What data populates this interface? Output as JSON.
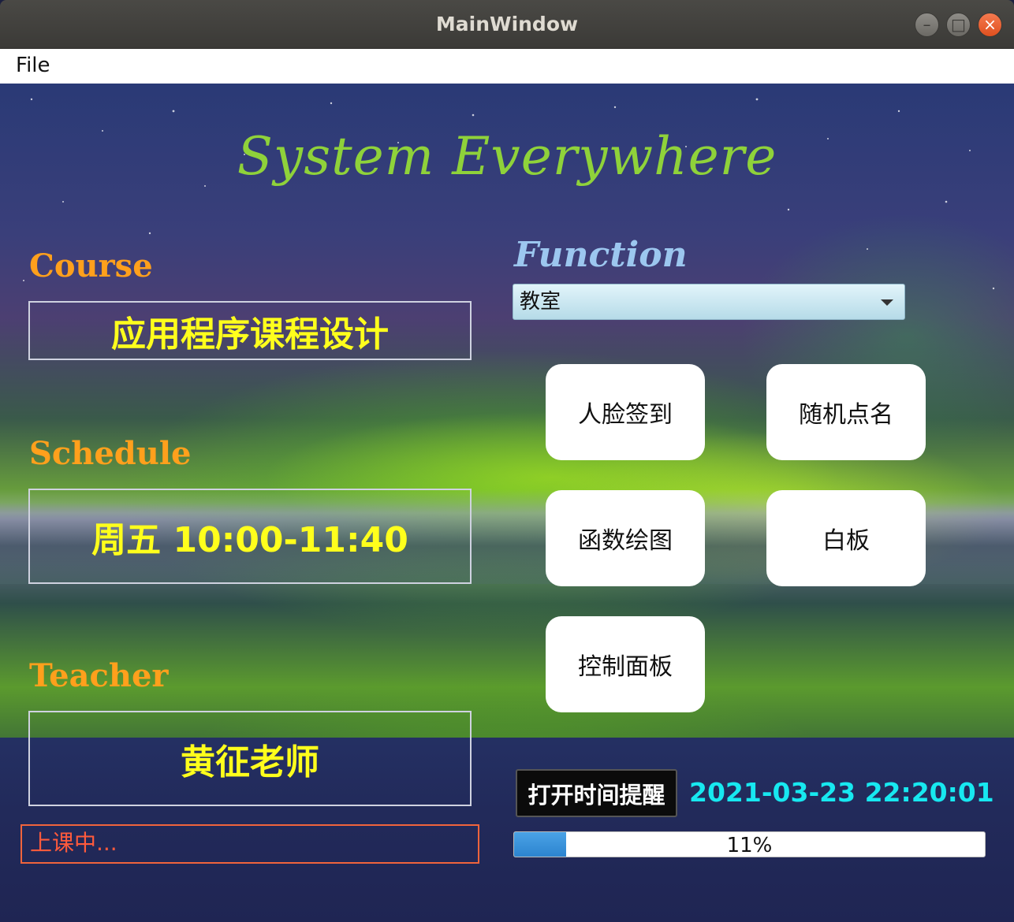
{
  "window": {
    "title": "MainWindow"
  },
  "menu": {
    "items": [
      "File"
    ]
  },
  "headline": "System  Everywhere",
  "left": {
    "course_label": "Course",
    "course_value": "应用程序课程设计",
    "schedule_label": "Schedule",
    "schedule_value": "周五 10:00-11:40",
    "teacher_label": "Teacher",
    "teacher_value": "黄征老师",
    "status_text": "上课中..."
  },
  "function": {
    "label": "Function",
    "combo_value": "教室",
    "buttons": [
      "人脸签到",
      "随机点名",
      "函数绘图",
      "白板",
      "控制面板"
    ]
  },
  "bottom": {
    "reminder_button": "打开时间提醒",
    "datetime": "2021-03-23 22:20:01",
    "progress_value": 0.11,
    "progress_text": "11%"
  },
  "colors": {
    "headline": "#8fd23a",
    "section_label": "#ffa01c",
    "info_text": "#ffff1c",
    "function_label": "#9cc7ef",
    "status_border": "#f0643c",
    "clock": "#17e8f0",
    "progress_fill": "#2c84cf"
  },
  "icons": {
    "window_controls": [
      "minimize-icon",
      "maximize-icon",
      "close-icon"
    ],
    "combo": "chevron-down-icon"
  }
}
